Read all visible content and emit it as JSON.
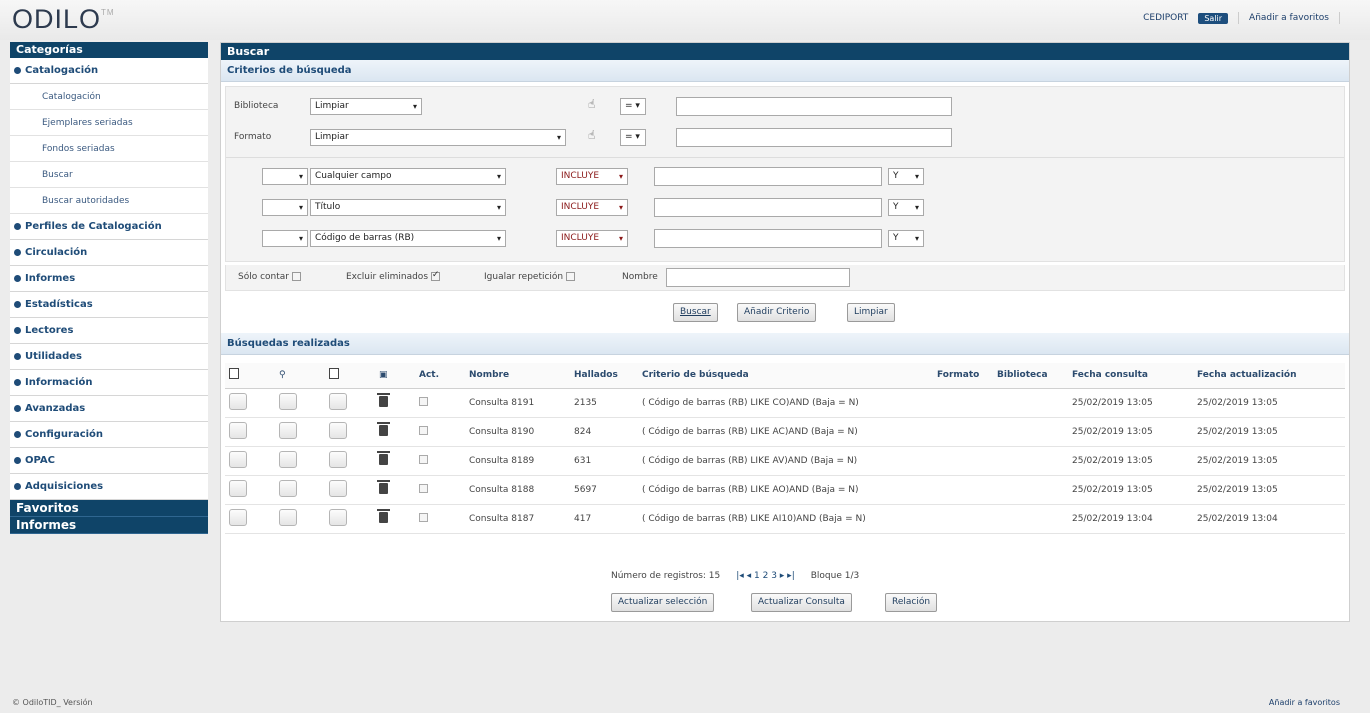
{
  "header": {
    "logo": "ODILO",
    "logo_tm": "TM",
    "user": "CEDIPORT",
    "salir": "Salir",
    "fav_link": "Añadir a favoritos"
  },
  "sidebar": {
    "categorias": "Categorías",
    "groups": [
      {
        "label": "Catalogación",
        "items": [
          "Catalogación",
          "Ejemplares seriadas",
          "Fondos seriadas",
          "Buscar",
          "Buscar autoridades"
        ]
      },
      {
        "label": "Perfiles de Catalogación"
      },
      {
        "label": "Circulación"
      },
      {
        "label": "Informes"
      },
      {
        "label": "Estadísticas"
      },
      {
        "label": "Lectores"
      },
      {
        "label": "Utilidades"
      },
      {
        "label": "Información"
      },
      {
        "label": "Avanzadas"
      },
      {
        "label": "Configuración"
      },
      {
        "label": "OPAC"
      },
      {
        "label": "Adquisiciones"
      }
    ],
    "favoritos": "Favoritos",
    "informes": "Informes"
  },
  "main": {
    "title": "Buscar",
    "criteria_title": "Criterios de búsqueda",
    "biblioteca_label": "Biblioteca",
    "biblioteca_value": "Limpiar",
    "formato_label": "Formato",
    "formato_value": "Limpiar",
    "eq_op": "= ▾",
    "rows": [
      {
        "field": "Cualquier campo",
        "op": "INCLUYE",
        "conj": "Y"
      },
      {
        "field": "Título",
        "op": "INCLUYE",
        "conj": "Y"
      },
      {
        "field": "Código de barras (RB)",
        "op": "INCLUYE",
        "conj": "Y"
      }
    ],
    "solo_contar": "Sólo contar",
    "excluir": "Excluir eliminados",
    "igualar": "Igualar repetición",
    "nombre": "Nombre",
    "btn_buscar": "Buscar",
    "btn_anadir": "Añadir Criterio",
    "btn_limpiar": "Limpiar",
    "searches_title": "Búsquedas realizadas",
    "columns": [
      "Act.",
      "Nombre",
      "Hallados",
      "Criterio de búsqueda",
      "Formato",
      "Biblioteca",
      "Fecha consulta",
      "Fecha actualización"
    ],
    "results": [
      {
        "name": "Consulta 8191",
        "found": "2135",
        "criteria": "( Código de barras (RB) LIKE CO)AND (Baja = N)",
        "fecha": "25/02/2019 13:05",
        "act": "25/02/2019 13:05"
      },
      {
        "name": "Consulta 8190",
        "found": "824",
        "criteria": "( Código de barras (RB) LIKE AC)AND (Baja = N)",
        "fecha": "25/02/2019 13:05",
        "act": "25/02/2019 13:05"
      },
      {
        "name": "Consulta 8189",
        "found": "631",
        "criteria": "( Código de barras (RB) LIKE AV)AND (Baja = N)",
        "fecha": "25/02/2019 13:05",
        "act": "25/02/2019 13:05"
      },
      {
        "name": "Consulta 8188",
        "found": "5697",
        "criteria": "( Código de barras (RB) LIKE AO)AND (Baja = N)",
        "fecha": "25/02/2019 13:05",
        "act": "25/02/2019 13:05"
      },
      {
        "name": "Consulta 8187",
        "found": "417",
        "criteria": "( Código de barras (RB) LIKE AI10)AND (Baja = N)",
        "fecha": "25/02/2019 13:04",
        "act": "25/02/2019 13:04"
      }
    ],
    "num_registros": "Número de registros: 15",
    "pages": "|◂ ◂  1 2 3  ▸ ▸|",
    "bloque": "Bloque 1/3",
    "btn_actualizar_sel": "Actualizar selección",
    "btn_actualizar_con": "Actualizar Consulta",
    "btn_relacion": "Relación"
  },
  "footer": {
    "left": "© OdiloTID_ Versión",
    "right": "Añadir a favoritos"
  }
}
